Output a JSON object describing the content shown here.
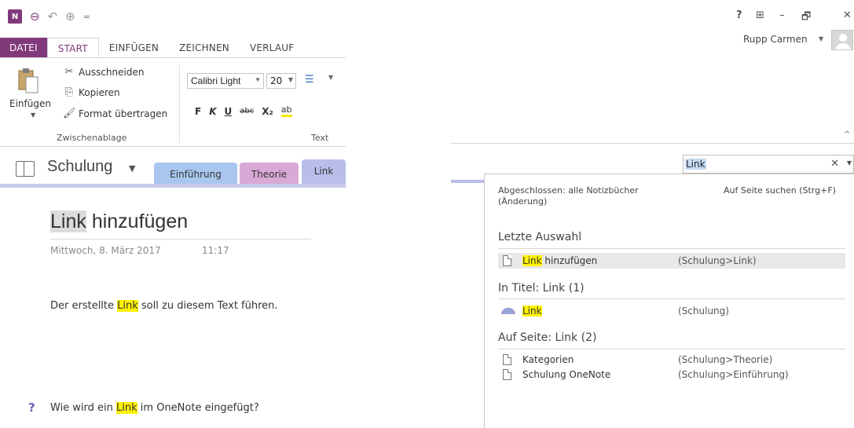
{
  "colors": {
    "accent": "#80397b",
    "search_highlight": "#fff200",
    "tab_einfuehrung": "#a9c6ef",
    "tab_theorie": "#d9a9d6",
    "tab_link": "#b8bee8"
  },
  "quick_access": {
    "icons": [
      "onenote-logo-icon",
      "back-icon",
      "undo-icon",
      "redo-icon",
      "customize-icon"
    ],
    "logo_text": "N"
  },
  "ribbon": {
    "tabs": [
      "DATEI",
      "START",
      "EINFÜGEN",
      "ZEICHNEN",
      "VERLAUF"
    ],
    "clipboard": {
      "paste": "Einfügen",
      "cut": "Ausschneiden",
      "copy": "Kopieren",
      "format_painter": "Format übertragen",
      "group_label": "Zwischenablage"
    },
    "text": {
      "font": "Calibri Light",
      "size": "20",
      "bold": "F",
      "italic": "K",
      "underline": "U",
      "strike": "abc",
      "subscript": "X₂",
      "highlight": "ab",
      "group_label": "Text"
    }
  },
  "notebook": {
    "name": "Schulung",
    "sections": [
      "Einführung",
      "Theorie",
      "Link"
    ]
  },
  "page": {
    "title_hit": "Link",
    "title_rest": " hinzufügen",
    "date": "Mittwoch, 8. März 2017",
    "time": "11:17",
    "body_pre": "Der erstellte ",
    "body_hit": "Link",
    "body_post": " soll zu diesem Text führen.",
    "question_pre": "Wie wird ein ",
    "question_hit": "Link",
    "question_post": " im OneNote eingefügt?"
  },
  "window": {
    "help": "?",
    "restore_ribbon": "⊞",
    "minimize": "–",
    "maximize": "🗗",
    "close": "✕"
  },
  "user": {
    "name": "Rupp Carmen"
  },
  "search": {
    "query": "Link",
    "scope": "Abgeschlossen: alle Notizbücher (Änderung)",
    "on_page": "Auf Seite suchen (Strg+F)",
    "recent": {
      "heading": "Letzte Auswahl",
      "items": [
        {
          "hit": "Link",
          "rest": " hinzufügen",
          "path": "(Schulung>Link)"
        }
      ]
    },
    "in_title": {
      "heading": "In Titel: Link (1)",
      "items": [
        {
          "hit": "Link",
          "rest": "",
          "path": "(Schulung)"
        }
      ]
    },
    "on_page_results": {
      "heading": "Auf Seite: Link (2)",
      "items": [
        {
          "name": "Kategorien",
          "path": "(Schulung>Theorie)"
        },
        {
          "name": "Schulung OneNote",
          "path": "(Schulung>Einführung)"
        }
      ]
    }
  }
}
